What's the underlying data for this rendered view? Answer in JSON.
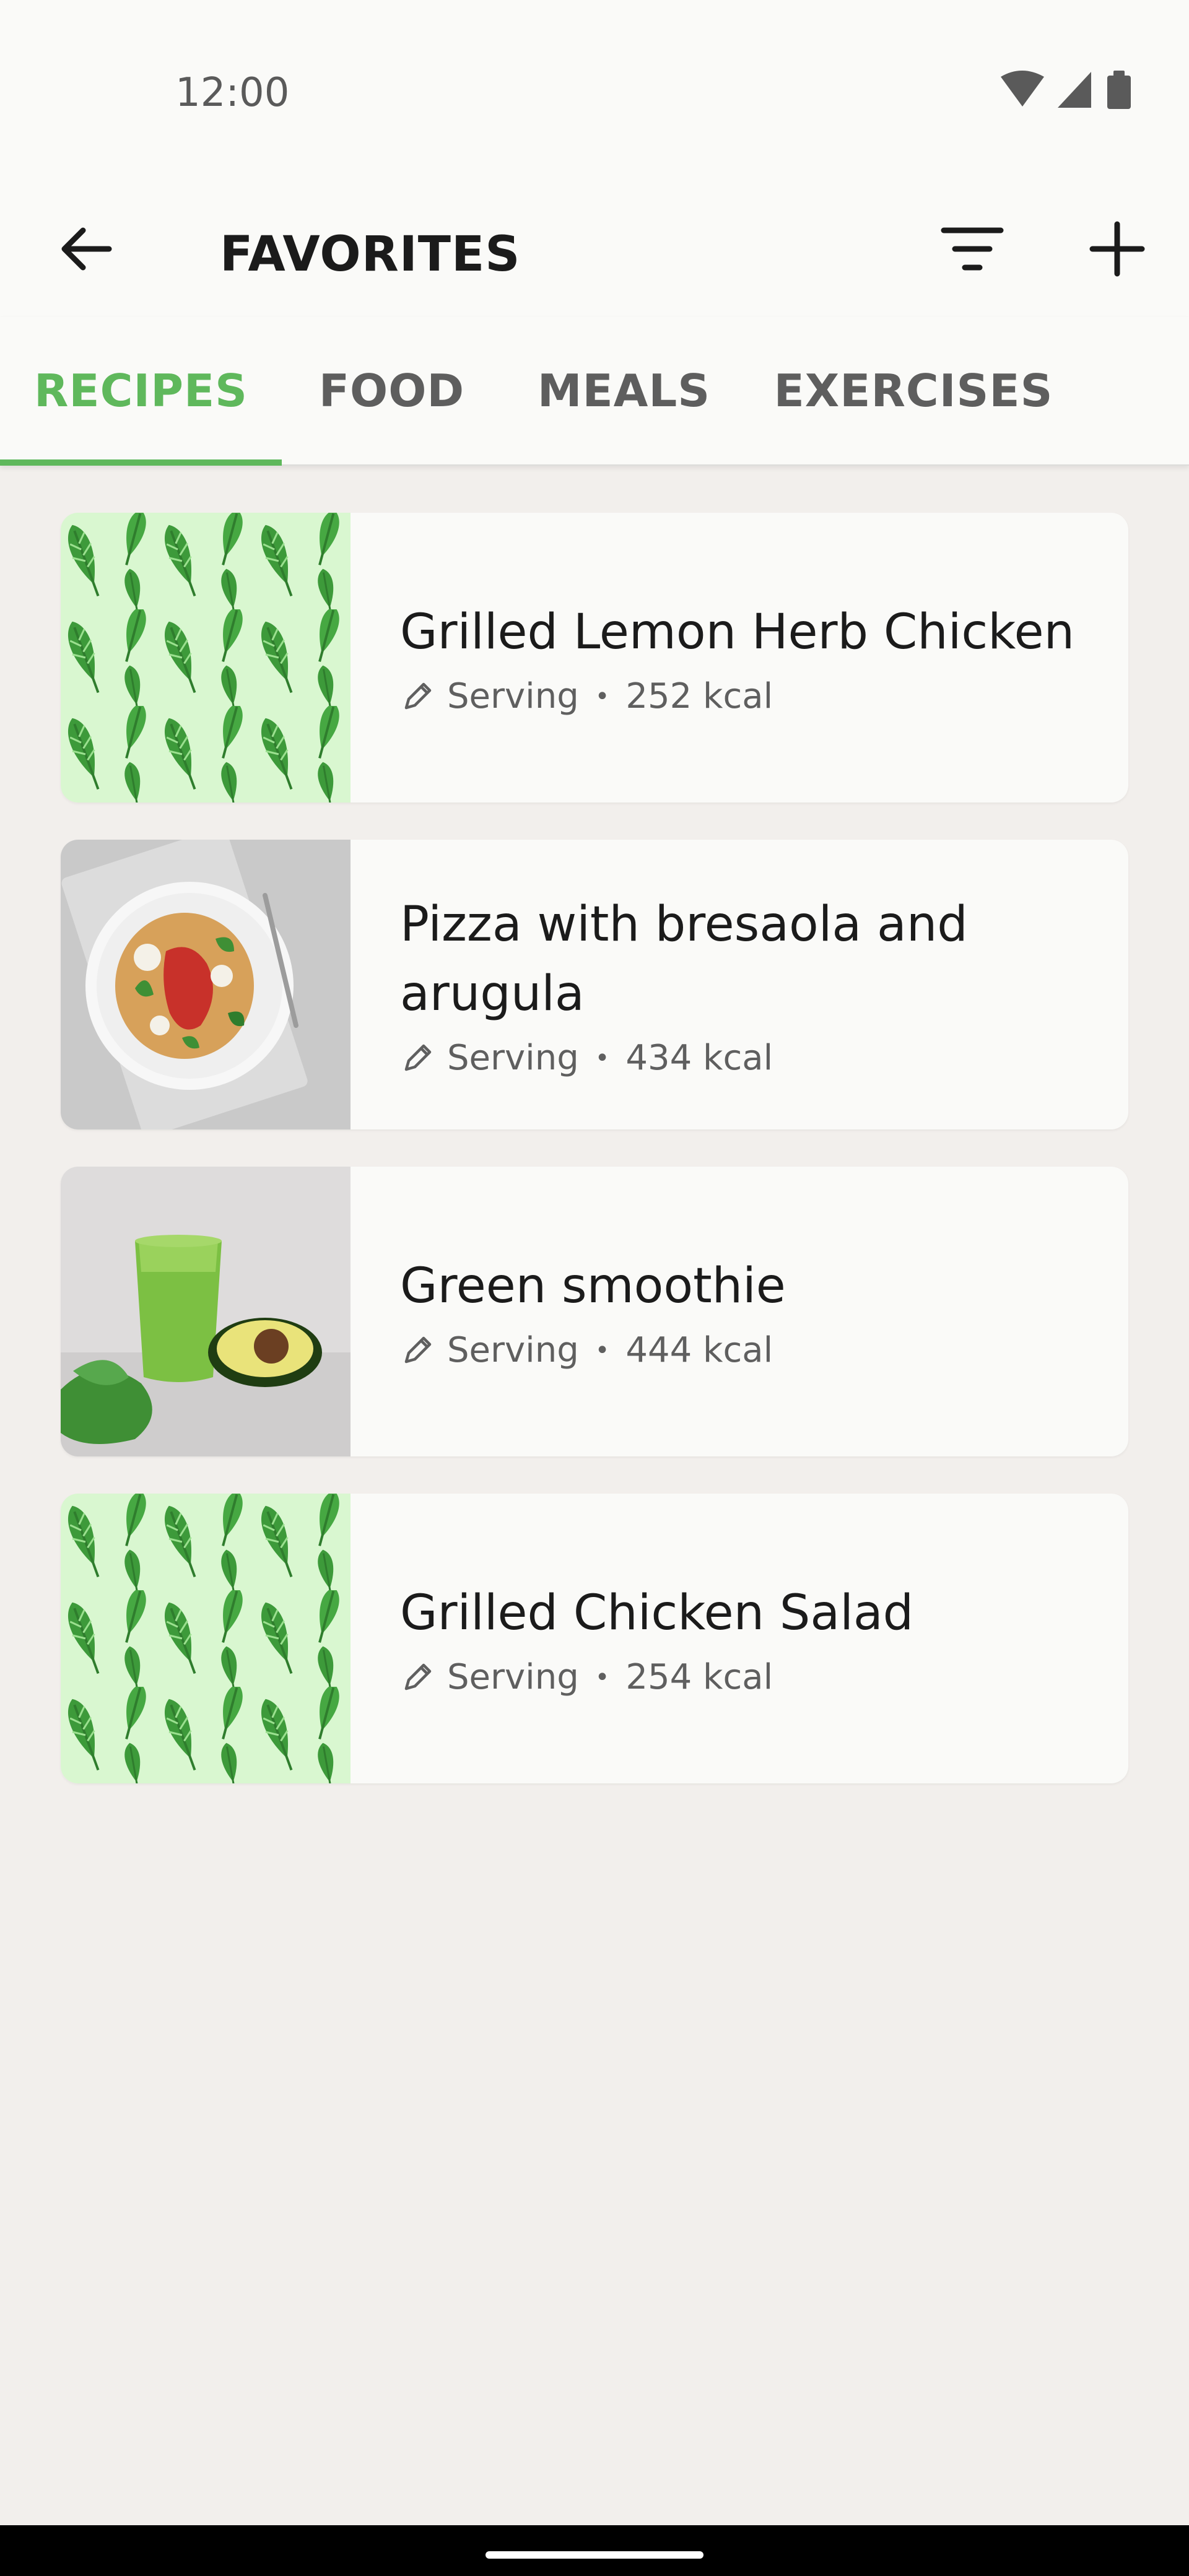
{
  "status_bar": {
    "time": "12:00",
    "icons": [
      "wifi-icon",
      "cellular-signal-icon",
      "battery-icon"
    ]
  },
  "app_bar": {
    "title": "FAVORITES",
    "back_icon": "arrow-left-icon",
    "filter_icon": "filter-lines-icon",
    "add_icon": "plus-icon"
  },
  "tabs": [
    {
      "label": "RECIPES",
      "active": true
    },
    {
      "label": "FOOD",
      "active": false
    },
    {
      "label": "MEALS",
      "active": false
    },
    {
      "label": "EXERCISES",
      "active": false
    }
  ],
  "recipes": [
    {
      "name": "Grilled Lemon Herb Chicken",
      "serving": "Serving",
      "kcal": "252 kcal",
      "image": "leaf-pattern"
    },
    {
      "name": "Pizza with bresaola and arugula",
      "serving": "Serving",
      "kcal": "434 kcal",
      "image": "pizza-photo"
    },
    {
      "name": "Green smoothie",
      "serving": "Serving",
      "kcal": "444 kcal",
      "image": "smoothie-photo"
    },
    {
      "name": "Grilled Chicken Salad",
      "serving": "Serving",
      "kcal": "254 kcal",
      "image": "leaf-pattern"
    }
  ],
  "colors": {
    "accent": "#5fb85c",
    "background": "#f2efec",
    "surface": "#fafaf8",
    "leaf_pattern_bg": "#d9f7d0",
    "leaf_dark": "#3d9a3a"
  }
}
